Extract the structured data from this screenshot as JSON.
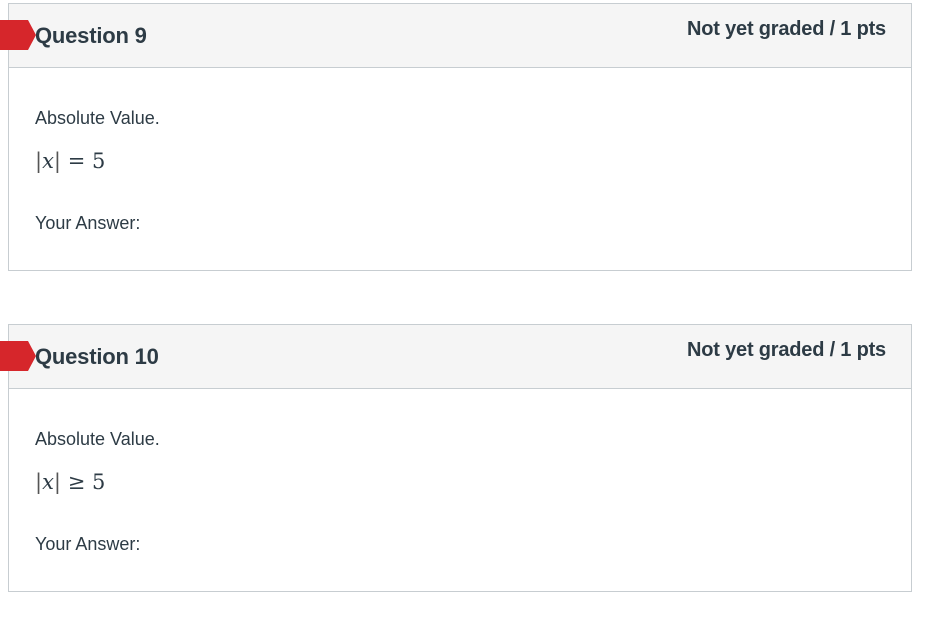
{
  "questions": [
    {
      "title": "Question 9",
      "points": "Not yet graded / 1 pts",
      "prompt": "Absolute Value.",
      "math": {
        "variable": "x",
        "operator": "=",
        "value": "5"
      },
      "answer_label": "Your Answer:"
    },
    {
      "title": "Question 10",
      "points": "Not yet graded / 1 pts",
      "prompt": "Absolute Value.",
      "math": {
        "variable": "x",
        "operator": "≥",
        "value": "5"
      },
      "answer_label": "Your Answer:"
    }
  ],
  "colors": {
    "flag": "#d6262b",
    "header_bg": "#f5f5f5",
    "border": "#c7cdd1",
    "text": "#2d3b45"
  },
  "icons": {
    "flag": "question-flag-icon"
  }
}
